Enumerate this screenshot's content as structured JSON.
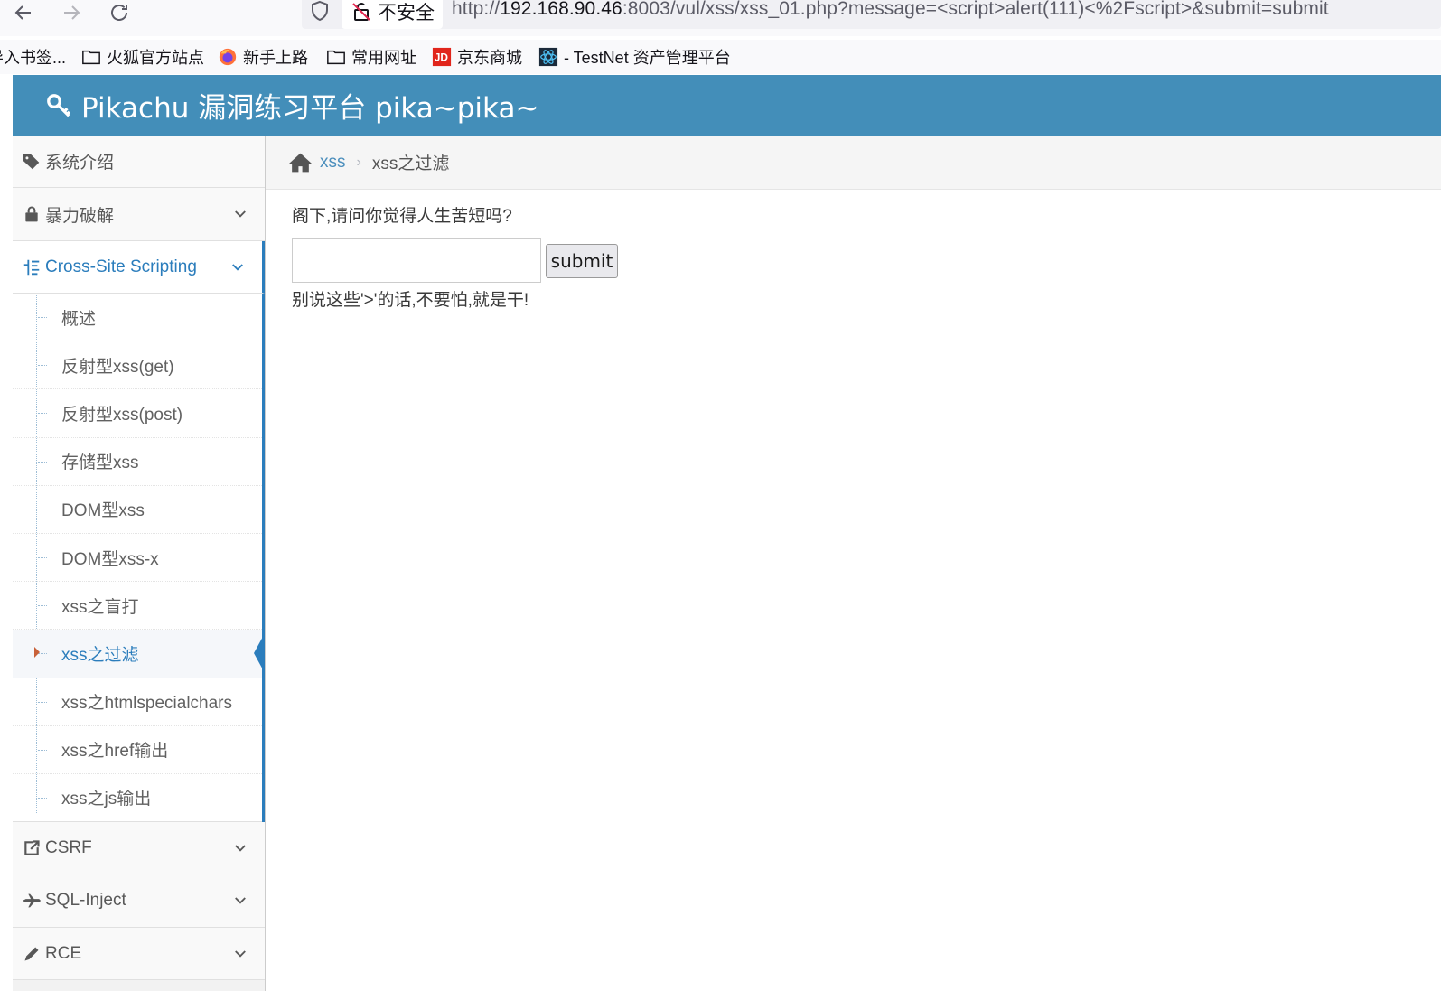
{
  "browser": {
    "security_label": "不安全",
    "url_prefix": "http://",
    "url_host": "192.168.90.46",
    "url_rest": ":8003/vul/xss/xss_01.php?message=<script>alert(111)<%2Fscript>&submit=submit"
  },
  "bookmarks": [
    {
      "label": "导入书签...",
      "icon": "none"
    },
    {
      "label": "火狐官方站点",
      "icon": "folder-icon"
    },
    {
      "label": "新手上路",
      "icon": "firefox-icon"
    },
    {
      "label": "常用网址",
      "icon": "folder-icon"
    },
    {
      "label": "京东商城",
      "icon": "jd-icon"
    },
    {
      "label": "- TestNet 资产管理平台",
      "icon": "testnet-icon"
    }
  ],
  "jd_logo_text": "JD",
  "header": {
    "title": "Pikachu 漏洞练习平台 pika~pika~"
  },
  "sidebar": {
    "items": [
      {
        "label": "系统介绍"
      },
      {
        "label": "暴力破解"
      },
      {
        "label": "Cross-Site Scripting"
      },
      {
        "label": "CSRF"
      },
      {
        "label": "SQL-Inject"
      },
      {
        "label": "RCE"
      }
    ],
    "xss_submenu": [
      {
        "label": "概述"
      },
      {
        "label": "反射型xss(get)"
      },
      {
        "label": "反射型xss(post)"
      },
      {
        "label": "存储型xss"
      },
      {
        "label": "DOM型xss"
      },
      {
        "label": "DOM型xss-x"
      },
      {
        "label": "xss之盲打"
      },
      {
        "label": "xss之过滤"
      },
      {
        "label": "xss之htmlspecialchars"
      },
      {
        "label": "xss之href输出"
      },
      {
        "label": "xss之js输出"
      }
    ]
  },
  "breadcrumb": {
    "parent": "xss",
    "separator": "›",
    "current": "xss之过滤"
  },
  "main": {
    "question": "阁下,请问你觉得人生苦短吗?",
    "input_value": "",
    "submit_label": "submit",
    "result_text": "别说这些'>'的话,不要怕,就是干!"
  },
  "colors": {
    "header_bg": "#438eb9",
    "accent": "#2b7dbc",
    "caret": "#c86139"
  }
}
